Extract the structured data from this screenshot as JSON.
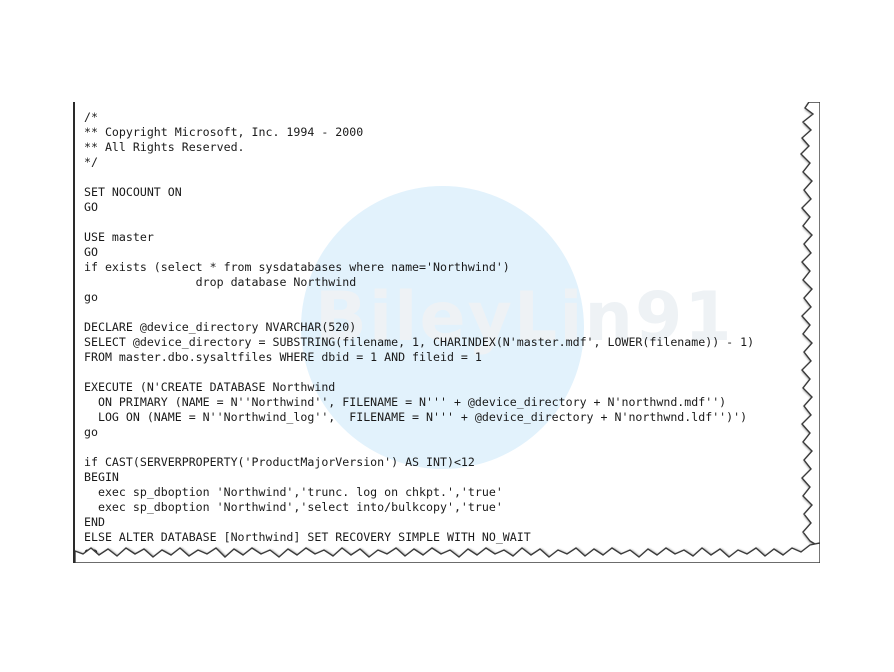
{
  "watermark": {
    "text": "BileyLin91"
  },
  "code": {
    "lines": [
      "/*",
      "** Copyright Microsoft, Inc. 1994 - 2000",
      "** All Rights Reserved.",
      "*/",
      "",
      "SET NOCOUNT ON",
      "GO",
      "",
      "USE master",
      "GO",
      "if exists (select * from sysdatabases where name='Northwind')",
      "                drop database Northwind",
      "go",
      "",
      "DECLARE @device_directory NVARCHAR(520)",
      "SELECT @device_directory = SUBSTRING(filename, 1, CHARINDEX(N'master.mdf', LOWER(filename)) - 1)",
      "FROM master.dbo.sysaltfiles WHERE dbid = 1 AND fileid = 1",
      "",
      "EXECUTE (N'CREATE DATABASE Northwind",
      "  ON PRIMARY (NAME = N''Northwind'', FILENAME = N''' + @device_directory + N'northwnd.mdf'')",
      "  LOG ON (NAME = N''Northwind_log'',  FILENAME = N''' + @device_directory + N'northwnd.ldf'')')",
      "go",
      "",
      "if CAST(SERVERPROPERTY('ProductMajorVersion') AS INT)<12",
      "BEGIN",
      "  exec sp_dboption 'Northwind','trunc. log on chkpt.','true'",
      "  exec sp_dboption 'Northwind','select into/bulkcopy','true'",
      "END",
      "ELSE ALTER DATABASE [Northwind] SET RECOVERY SIMPLE WITH NO_WAIT",
      "go"
    ]
  }
}
